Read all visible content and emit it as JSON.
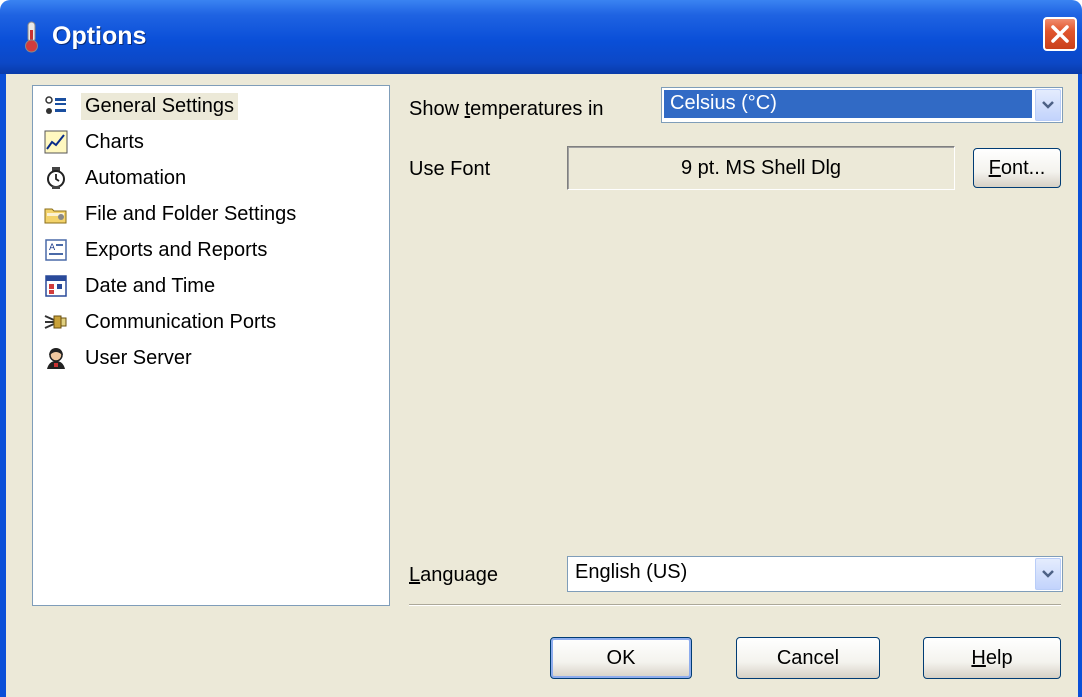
{
  "window": {
    "title": "Options",
    "close_label": "×"
  },
  "categories": [
    {
      "label": "General Settings",
      "icon": "general-settings-icon",
      "selected": true
    },
    {
      "label": "Charts",
      "icon": "charts-icon",
      "selected": false
    },
    {
      "label": "Automation",
      "icon": "automation-icon",
      "selected": false
    },
    {
      "label": "File and Folder Settings",
      "icon": "folder-settings-icon",
      "selected": false
    },
    {
      "label": "Exports and Reports",
      "icon": "exports-reports-icon",
      "selected": false
    },
    {
      "label": "Date and Time",
      "icon": "calendar-icon",
      "selected": false
    },
    {
      "label": "Communication Ports",
      "icon": "communication-ports-icon",
      "selected": false
    },
    {
      "label": "User Server",
      "icon": "user-server-icon",
      "selected": false
    }
  ],
  "settings": {
    "temp_label_pre": "Show ",
    "temp_label_key": "t",
    "temp_label_post": "emperatures in",
    "temp_value": "Celsius (°C)",
    "font_label": "Use Font",
    "font_value": "9 pt. MS Shell Dlg",
    "font_button_key": "F",
    "font_button_post": "ont...",
    "language_label_key": "L",
    "language_label_post": "anguage",
    "language_value": "English (US)"
  },
  "buttons": {
    "ok": "OK",
    "cancel": "Cancel",
    "help_key": "H",
    "help_post": "elp"
  },
  "colors": {
    "title_bar": "#0a4fd8",
    "client": "#ece9d8",
    "selection": "#316ac5",
    "close": "#e1552d"
  }
}
